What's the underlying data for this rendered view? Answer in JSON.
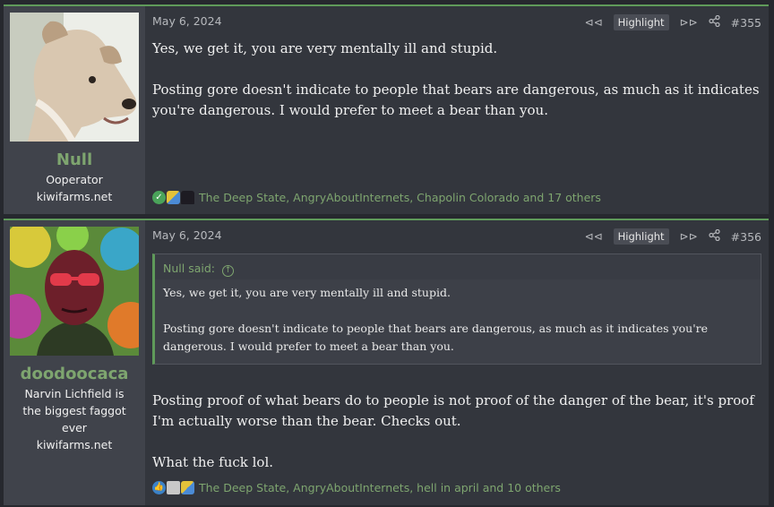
{
  "posts": [
    {
      "user": {
        "name": "Null",
        "title": "Ooperator",
        "site": "kiwifarms.net"
      },
      "date": "May 6, 2024",
      "highlight_label": "Highlight",
      "number": "#355",
      "body": [
        "Yes, we get it, you are very mentally ill and stupid.",
        "Posting gore doesn't indicate to people that bears are dangerous, as much as it indicates you're dangerous. I would prefer to meet a bear than you."
      ],
      "reactions_text": "The Deep State, AngryAboutInternets, Chapolin Colorado and 17 others",
      "reaction_icons": [
        "check-icon",
        "puzzle-icon",
        "tophat-icon"
      ]
    },
    {
      "user": {
        "name": "doodoocaca",
        "title": "Narvin Lichfield is the biggest faggot ever",
        "site": "kiwifarms.net"
      },
      "date": "May 6, 2024",
      "highlight_label": "Highlight",
      "number": "#356",
      "quote": {
        "author": "Null said:",
        "lines": [
          "Yes, we get it, you are very mentally ill and stupid.",
          "Posting gore doesn't indicate to people that bears are dangerous, as much as it indicates you're dangerous. I would prefer to meet a bear than you."
        ]
      },
      "body": [
        "Posting proof of what bears do to people is not proof of the danger of the bear, it's proof I'm actually worse than the bear. Checks out.",
        "What the fuck lol."
      ],
      "reactions_text": "The Deep State, AngryAboutInternets, hell in april and 10 others",
      "reaction_icons": [
        "like-icon",
        "document-icon",
        "puzzle-icon"
      ]
    }
  ],
  "colors": {
    "accent": "#7ea56f",
    "border": "#5f9a5a",
    "panel": "#33363d",
    "sidebar": "#40434b"
  }
}
